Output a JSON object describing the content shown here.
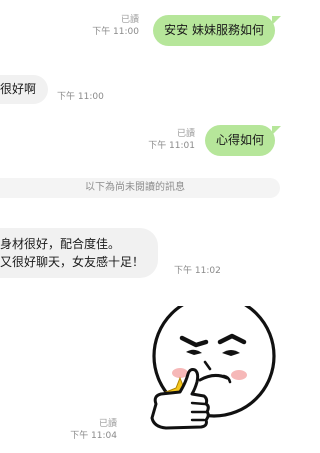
{
  "messages": [
    {
      "direction": "out",
      "text": "安安 妹妹服務如何",
      "read": "已讀",
      "time": "下午 11:00"
    },
    {
      "direction": "in",
      "text": "很好啊",
      "time": "下午 11:00"
    },
    {
      "direction": "out",
      "text": "心得如何",
      "read": "已讀",
      "time": "下午 11:01"
    },
    {
      "direction": "in",
      "line1": "身材很好，配合度佳。",
      "line2": "又很好聊天，女友感十足！",
      "time": "下午 11:02"
    }
  ],
  "divider_text": "以下為尚未閱讀的訊息",
  "sticker": {
    "icon": "thumbs-up-smirk-sticker",
    "read": "已讀",
    "time": "下午 11:04"
  },
  "colors": {
    "outgoing_bubble": "#b6e69a",
    "incoming_bubble": "#f1f1f1",
    "meta_text": "#9a9a9a"
  }
}
